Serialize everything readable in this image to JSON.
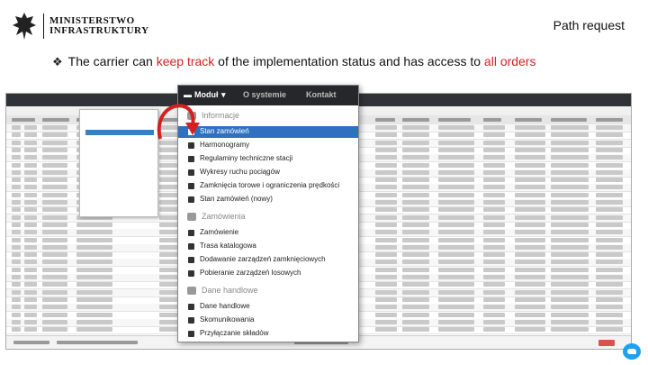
{
  "logo": {
    "line1": "MINISTERSTWO",
    "line2": "INFRASTRUKTURY"
  },
  "slide_title": "Path request",
  "bullet": {
    "before": "The carrier can ",
    "hl1": "keep track",
    "middle": " of the implementation status and has access to ",
    "hl2": "all orders"
  },
  "menu": {
    "bar": {
      "modul": "Moduł",
      "o_systemie": "O systemie",
      "kontakt": "Kontakt"
    },
    "sections": [
      {
        "label": "Informacje",
        "items": [
          "Stan zamówień",
          "Harmonogramy",
          "Regulaminy techniczne stacji",
          "Wykresy ruchu pociągów",
          "Zamknięcia torowe i ograniczenia prędkości",
          "Stan zamówień (nowy)"
        ]
      },
      {
        "label": "Zamówienia",
        "items": [
          "Zamówienie",
          "Trasa katalogowa",
          "Dodawanie zarządzeń zamknięciowych",
          "Pobieranie zarządzeń losowych"
        ]
      },
      {
        "label": "Dane handlowe",
        "items": [
          "Dane handlowe",
          "Skomunikowania",
          "Przyłączanie składów"
        ]
      }
    ]
  },
  "colors": {
    "highlight": "#d42020",
    "active_item": "#2f71c0",
    "menu_bar": "#25272a",
    "arrow": "#d42020"
  }
}
